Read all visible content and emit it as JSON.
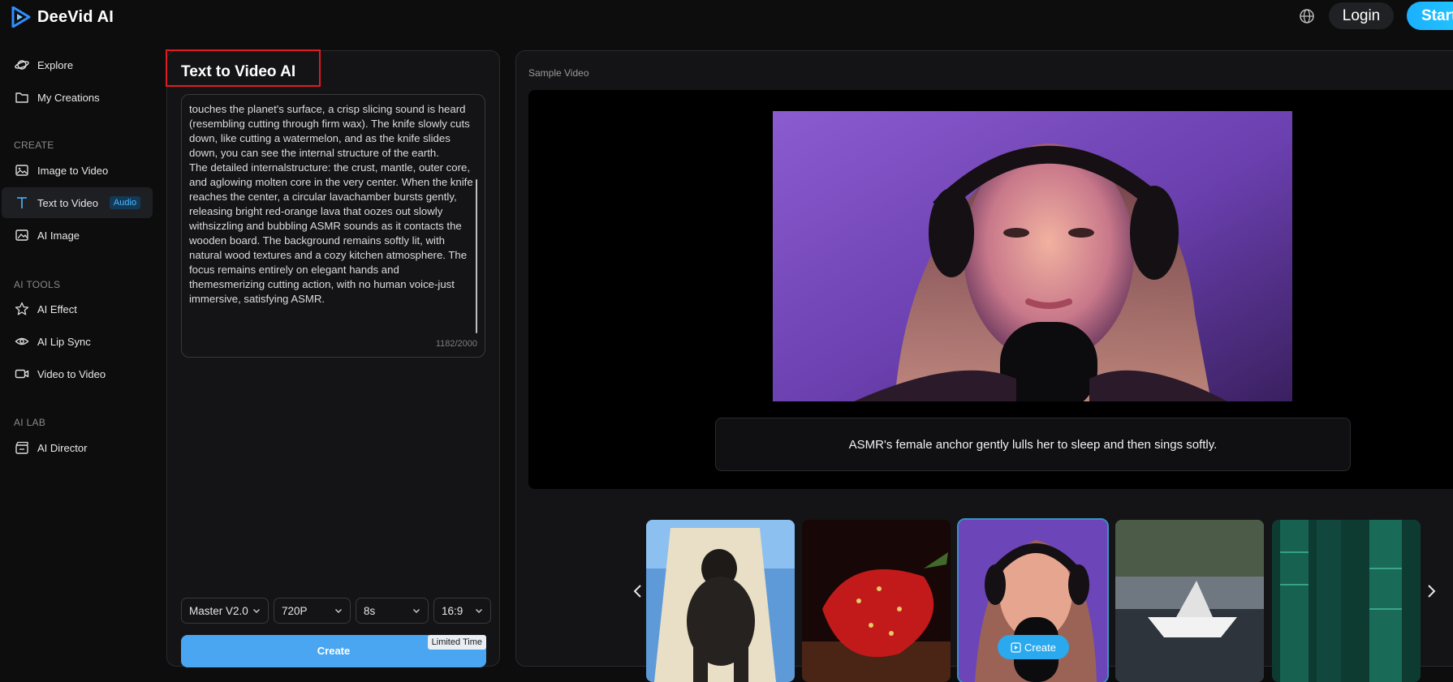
{
  "app": {
    "title": "DeeVid AI"
  },
  "header": {
    "login_label": "Login",
    "start_label": "Start"
  },
  "sidebar": {
    "items_top": [
      {
        "label": "Explore",
        "icon": "planet-icon"
      },
      {
        "label": "My Creations",
        "icon": "folder-icon"
      }
    ],
    "sections": [
      {
        "title": "CREATE",
        "items": [
          {
            "label": "Image to Video",
            "icon": "image-icon"
          },
          {
            "label": "Text to Video",
            "icon": "text-icon",
            "badge": "Audio",
            "active": true
          },
          {
            "label": "AI Image",
            "icon": "ai-image-icon"
          }
        ]
      },
      {
        "title": "AI TOOLS",
        "items": [
          {
            "label": "AI Effect",
            "icon": "star-icon"
          },
          {
            "label": "AI Lip Sync",
            "icon": "eye-icon"
          },
          {
            "label": "Video to Video",
            "icon": "video-icon"
          }
        ]
      },
      {
        "title": "AI LAB",
        "items": [
          {
            "label": "AI Director",
            "icon": "director-icon"
          }
        ]
      }
    ]
  },
  "editor": {
    "title": "Text to Video AI",
    "prompt": "touches the planet's surface, a crisp slicing sound is heard (resembling cutting through firm wax). The knife slowly cuts down, like cutting a watermelon, and as the knife slides down, you can see the internal structure of the earth.\nThe detailed internalstructure: the crust, mantle, outer core, and aglowing molten core in the very center. When the knife reaches the center, a circular lavachamber bursts gently, releasing bright red-orange lava that oozes out slowly withsizzling and bubbling ASMR sounds as it contacts the wooden board. The background remains softly lit, with natural wood textures and a cozy kitchen atmosphere. The focus remains entirely on elegant hands and themesmerizing cutting action, with no human voice-just immersive, satisfying ASMR.",
    "counter": "1182/2000",
    "selects": {
      "model": "Master V2.0",
      "resolution": "720P",
      "duration": "8s",
      "ratio": "16:9"
    },
    "create_label": "Create",
    "limited_label": "Limited Time"
  },
  "preview": {
    "label": "Sample Video",
    "caption": "ASMR's female anchor gently lulls her to sleep and then sings softly.",
    "thumb_create_label": "Create",
    "selected_thumb": 3
  },
  "colors": {
    "accent": "#2aa9ee",
    "highlight": "#e11b22",
    "background": "#0d0d0e"
  }
}
